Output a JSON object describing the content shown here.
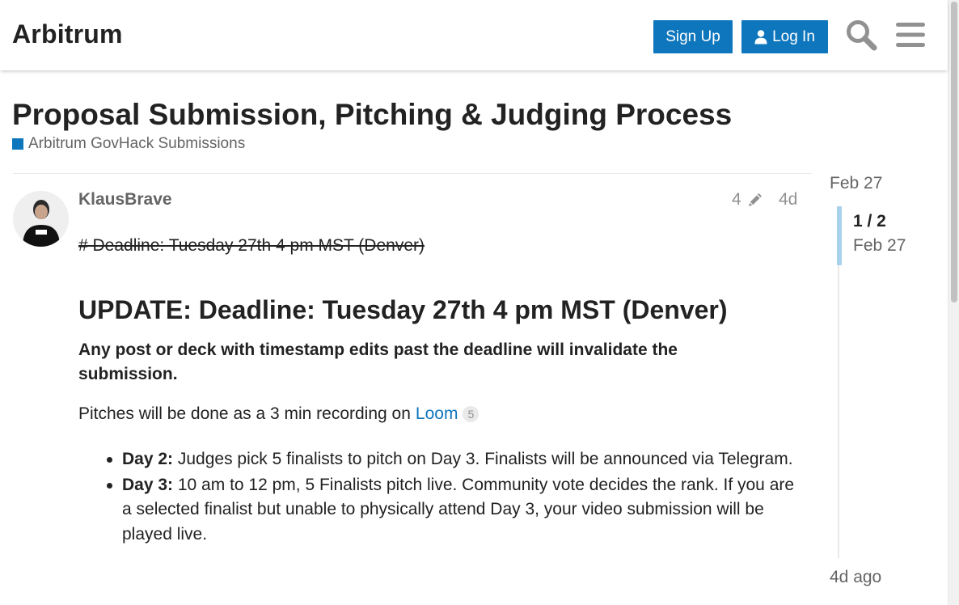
{
  "header": {
    "site_title": "Arbitrum",
    "signup_label": "Sign Up",
    "login_label": "Log In",
    "accent_color": "#0e76bd"
  },
  "topic": {
    "title": "Proposal Submission, Pitching & Judging Process",
    "category": "Arbitrum GovHack Submissions"
  },
  "post": {
    "username": "KlausBrave",
    "edit_count": "4",
    "age": "4d",
    "strikethrough_heading": "# Deadline: Tuesday 27th 4 pm MST (Denver)",
    "update_heading": "UPDATE: Deadline: Tuesday 27th 4 pm MST (Denver)",
    "bold_paragraph": "Any post or deck with timestamp edits past the deadline will invalidate the submission.",
    "pitch_text": "Pitches will be done as a 3 min recording on",
    "loom_link": "Loom",
    "loom_clicks": "5",
    "bullets": [
      {
        "label": "Day 2:",
        "text": " Judges pick 5 finalists to pitch on Day 3. Finalists will be announced via Telegram."
      },
      {
        "label": "Day 3:",
        "text": " 10 am to 12 pm, 5 Finalists pitch live. Community vote decides the rank. If you are a selected finalist but unable to physically attend Day 3, your video submission will be played live."
      }
    ]
  },
  "timeline": {
    "start_date": "Feb 27",
    "position": "1 / 2",
    "current_date": "Feb 27",
    "end_label": "4d ago"
  },
  "icons": {
    "search": "search-icon",
    "menu": "hamburger-menu-icon",
    "user": "user-icon",
    "edit": "pencil-icon"
  }
}
